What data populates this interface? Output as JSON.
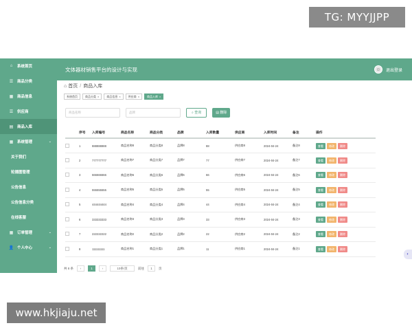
{
  "watermarks": {
    "top": "TG: MYYJJPP",
    "bottom": "www.hkjiaju.net"
  },
  "header": {
    "title": "文体器材销售平台的设计与实现",
    "user": "退出登录"
  },
  "sidebar": {
    "items": [
      {
        "icon": "⌂",
        "label": "系统首页"
      },
      {
        "icon": "☰",
        "label": "商品分类"
      },
      {
        "icon": "▦",
        "label": "商品信息"
      },
      {
        "icon": "☰",
        "label": "供应商"
      },
      {
        "icon": "▤",
        "label": "商品入库"
      },
      {
        "icon": "▦",
        "label": "系统管理",
        "chevron": "⌄"
      }
    ],
    "sub_items": [
      "关于我们",
      "轮播图管理",
      "公告信息",
      "公告信息分类",
      "在线客服"
    ],
    "bottom_items": [
      {
        "icon": "▦",
        "label": "订单管理",
        "chevron": "⌄"
      },
      {
        "icon": "👤",
        "label": "个人中心",
        "chevron": "⌄"
      }
    ]
  },
  "breadcrumb": {
    "home": "首页",
    "current": "商品入库"
  },
  "tags": [
    "系统首页",
    "商品分类",
    "商品信息",
    "供应商",
    "商品入库"
  ],
  "search": {
    "placeholder1": "商品名称",
    "placeholder2": "品牌",
    "query_label": "查询",
    "delete_label": "删除"
  },
  "table": {
    "headers": [
      "序号",
      "入库编号",
      "商品名称",
      "商品分类",
      "品牌",
      "入库数量",
      "供应商",
      "入库时间",
      "备注",
      "操作"
    ],
    "rows": [
      [
        "1",
        "888888888",
        "商品名称8",
        "商品分类8",
        "品牌8",
        "88",
        "供应商8",
        "2024-04-24",
        "备注8"
      ],
      [
        "2",
        "777777777",
        "商品名称7",
        "商品分类7",
        "品牌7",
        "77",
        "供应商7",
        "2024-04-24",
        "备注7"
      ],
      [
        "3",
        "666666666",
        "商品名称6",
        "商品分类6",
        "品牌6",
        "66",
        "供应商6",
        "2024-04-24",
        "备注6"
      ],
      [
        "4",
        "555555555",
        "商品名称5",
        "商品分类5",
        "品牌5",
        "55",
        "供应商5",
        "2024-04-24",
        "备注5"
      ],
      [
        "5",
        "444444444",
        "商品名称4",
        "商品分类4",
        "品牌4",
        "44",
        "供应商4",
        "2024-04-24",
        "备注4"
      ],
      [
        "6",
        "333333333",
        "商品名称3",
        "商品分类3",
        "品牌3",
        "33",
        "供应商3",
        "2024-04-24",
        "备注3"
      ],
      [
        "7",
        "222222222",
        "商品名称2",
        "商品分类2",
        "品牌2",
        "22",
        "供应商2",
        "2024-04-24",
        "备注2"
      ],
      [
        "8",
        "111111111",
        "商品名称1",
        "商品分类1",
        "品牌1",
        "11",
        "供应商1",
        "2024-04-24",
        "备注1"
      ]
    ],
    "ops": {
      "view": "查看",
      "edit": "修改",
      "delete": "删除"
    }
  },
  "pager": {
    "total": "共 8 条",
    "prev": "‹",
    "current": "1",
    "next": "›",
    "size": "10条/页",
    "goto": "前往",
    "page_input": "1",
    "page_suffix": "页"
  },
  "colors": {
    "brand": "#5fa88b",
    "edit": "#f2b46b",
    "delete": "#f08a88"
  }
}
